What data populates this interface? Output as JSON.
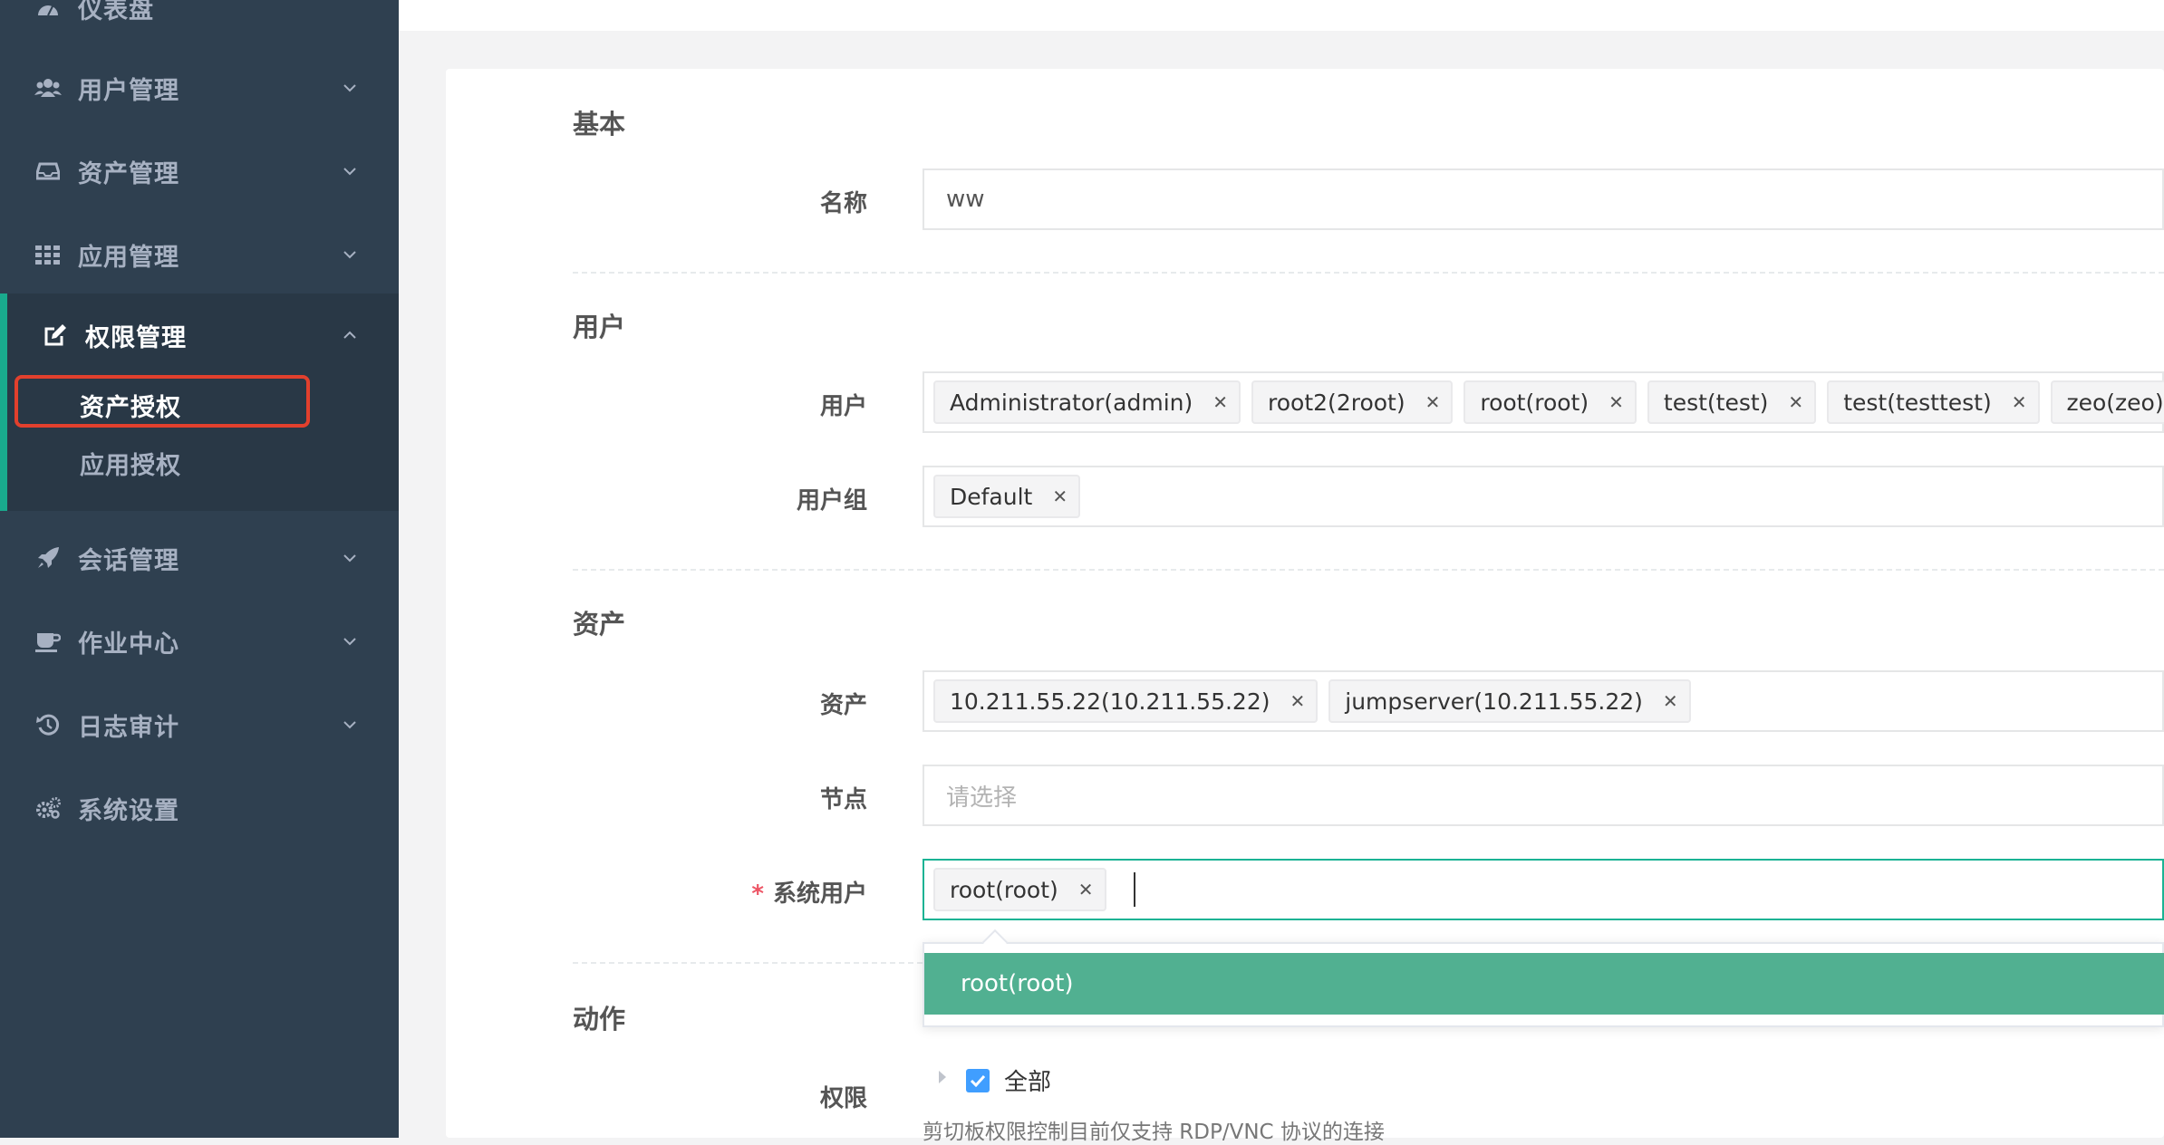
{
  "sidebar": {
    "items": [
      {
        "label": "仪表盘",
        "icon": "dashboard-icon"
      },
      {
        "label": "用户管理",
        "icon": "users-icon"
      },
      {
        "label": "资产管理",
        "icon": "inbox-icon"
      },
      {
        "label": "应用管理",
        "icon": "grid-icon"
      },
      {
        "label": "权限管理",
        "icon": "edit-icon"
      },
      {
        "label": "会话管理",
        "icon": "rocket-icon"
      },
      {
        "label": "作业中心",
        "icon": "coffee-icon"
      },
      {
        "label": "日志审计",
        "icon": "history-icon"
      },
      {
        "label": "系统设置",
        "icon": "cogs-icon"
      }
    ],
    "sub_items": [
      {
        "label": "资产授权"
      },
      {
        "label": "应用授权"
      }
    ]
  },
  "form": {
    "sections": {
      "basic": "基本",
      "user": "用户",
      "asset": "资产",
      "action": "动作"
    },
    "labels": {
      "name": "名称",
      "users": "用户",
      "user_groups": "用户组",
      "assets": "资产",
      "nodes": "节点",
      "system_users": "系统用户",
      "permissions": "权限"
    },
    "required_mark": "*",
    "name_value": "ww",
    "users": [
      "Administrator(admin)",
      "root2(2root)",
      "root(root)",
      "test(test)",
      "test(testtest)",
      "zeo(zeo)"
    ],
    "user_groups": [
      "Default"
    ],
    "assets": [
      "10.211.55.22(10.211.55.22)",
      "jumpserver(10.211.55.22)"
    ],
    "nodes_placeholder": "请选择",
    "system_users": [
      "root(root)"
    ],
    "dropdown_option": "root(root)",
    "permission_all": "全部",
    "hint": "剪切板权限控制目前仅支持 RDP/VNC 协议的连接"
  },
  "colors": {
    "sidebar_bg": "#2f4050",
    "active_accent": "#19aa8d",
    "highlight_border": "#e2402d",
    "dropdown_selected": "#51b091",
    "checkbox": "#409eff"
  }
}
